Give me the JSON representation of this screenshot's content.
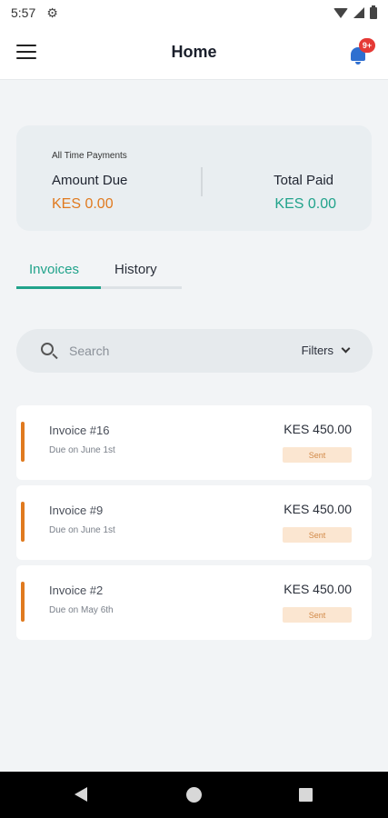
{
  "status_bar": {
    "time": "5:57",
    "icons": [
      "gear-icon",
      "wifi-icon",
      "signal-icon",
      "battery-icon"
    ]
  },
  "header": {
    "title": "Home",
    "notification_badge": "9+",
    "icons": [
      "menu-icon",
      "bell-icon"
    ]
  },
  "summary": {
    "caption": "All Time Payments",
    "amount_due_label": "Amount Due",
    "amount_due_value": "KES 0.00",
    "total_paid_label": "Total Paid",
    "total_paid_value": "KES 0.00"
  },
  "tabs": [
    {
      "label": "Invoices",
      "active": true
    },
    {
      "label": "History",
      "active": false
    }
  ],
  "search": {
    "placeholder": "Search",
    "filters_label": "Filters"
  },
  "invoices": [
    {
      "title": "Invoice #16",
      "due": "Due on June 1st",
      "amount": "KES 450.00",
      "status": "Sent"
    },
    {
      "title": "Invoice #9",
      "due": "Due on June 1st",
      "amount": "KES 450.00",
      "status": "Sent"
    },
    {
      "title": "Invoice #2",
      "due": "Due on May 6th",
      "amount": "KES 450.00",
      "status": "Sent"
    }
  ],
  "colors": {
    "accent_green": "#21a38b",
    "accent_orange": "#e07a1f",
    "badge_red": "#e53935",
    "bell_blue": "#2e6fd0",
    "status_bg": "#fbe6d1"
  }
}
